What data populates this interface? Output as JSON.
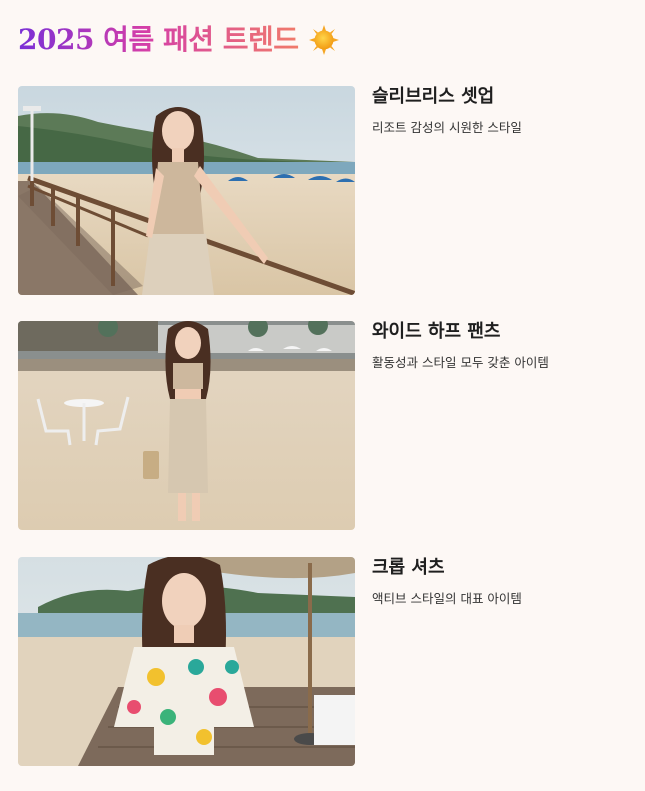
{
  "header": {
    "title": "2025 여름 패션 트렌드",
    "emoji_icon": "sun-icon"
  },
  "colors": {
    "background": "#fdf8f5",
    "title_gradient_start": "#7a2fd6",
    "title_gradient_mid": "#d43ea8",
    "title_gradient_end": "#f07b6a"
  },
  "items": [
    {
      "title": "슬리브리스 셋업",
      "description": "리조트 감성의 시원한 스타일",
      "image_icon": "photo-woman-sleeveless-beach-boardwalk"
    },
    {
      "title": "와이드 하프 팬츠",
      "description": "활동성과 스타일 모두 갖춘 아이템",
      "image_icon": "photo-woman-wide-half-pants-beach"
    },
    {
      "title": "크롭 셔츠",
      "description": "액티브 스타일의 대표 아이템",
      "image_icon": "photo-woman-crop-shirt-beach-deck"
    }
  ]
}
